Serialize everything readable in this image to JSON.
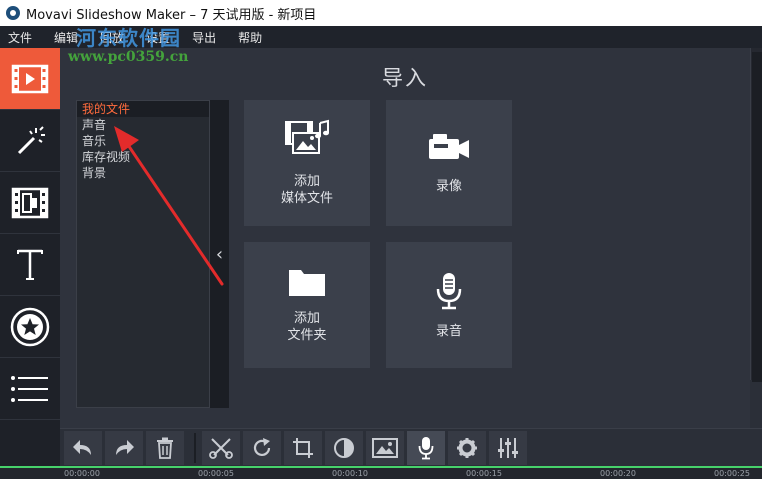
{
  "window": {
    "title": "Movavi Slideshow Maker – 7 天试用版 - 新项目"
  },
  "menu": [
    "文件",
    "编辑",
    "回放",
    "设置",
    "导出",
    "帮助"
  ],
  "rail": {
    "icons": [
      "film-import-icon",
      "magic-wand-icon",
      "transition-icon",
      "text-icon",
      "star-sticker-icon",
      "list-icon"
    ],
    "active_index": 0
  },
  "import": {
    "title": "导入",
    "file_tree": [
      "我的文件",
      "声音",
      "音乐",
      "库存视频",
      "背景"
    ],
    "selected_index": 0,
    "tiles": {
      "add_media": {
        "line1": "添加",
        "line2": "媒体文件"
      },
      "record_video": {
        "label": "录像"
      },
      "add_folder": {
        "line1": "添加",
        "line2": "文件夹"
      },
      "record_audio": {
        "label": "录音"
      }
    }
  },
  "toolbar": [
    "undo-icon",
    "redo-icon",
    "delete-icon",
    "cut-icon",
    "rotate-icon",
    "crop-icon",
    "color-adjust-icon",
    "image-icon",
    "microphone-icon",
    "settings-icon",
    "equalizer-icon"
  ],
  "timeline": {
    "marks": [
      "00:00:00",
      "00:00:05",
      "00:00:10",
      "00:00:15",
      "00:00:20",
      "00:00:25"
    ]
  },
  "watermark": {
    "title": "河东软件园",
    "url": "www.pc0359.cn"
  },
  "colors": {
    "accent": "#ee5a3a",
    "selected_text": "#ff6b3d",
    "annotation_arrow": "#e32b2b",
    "timeline_green": "#47d26b"
  }
}
